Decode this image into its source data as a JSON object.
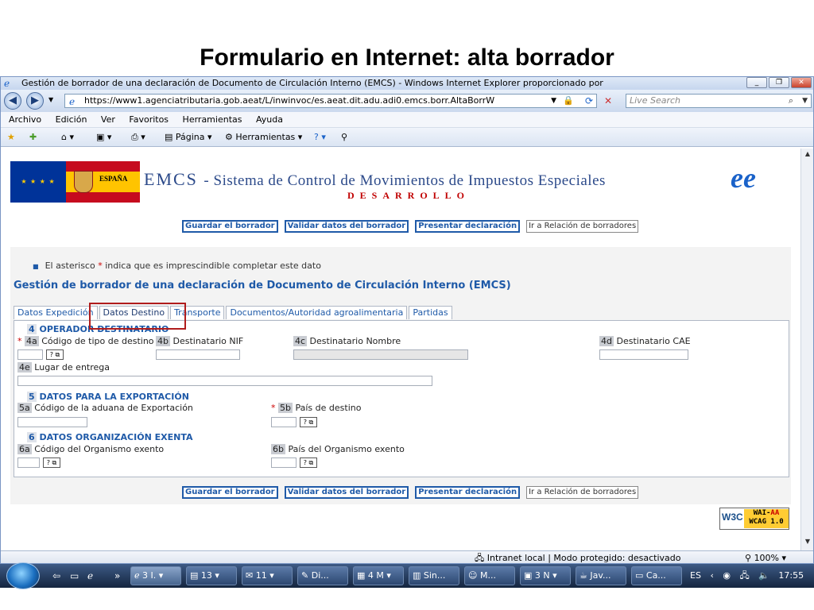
{
  "slide_title": "Formulario en Internet: alta borrador",
  "window": {
    "title": "Gestión de borrador de una declaración de Documento de Circulación Interno (EMCS) - Windows Internet Explorer proporcionado por",
    "url": "https://www1.agenciatributaria.gob.aeat/L/inwinvoc/es.aeat.dit.adu.adi0.emcs.borr.AltaBorrW",
    "search_placeholder": "Live Search",
    "menu": [
      "Archivo",
      "Edición",
      "Ver",
      "Favoritos",
      "Herramientas",
      "Ayuda"
    ],
    "toolbar": {
      "page": "Página",
      "tools": "Herramientas"
    }
  },
  "banner": {
    "emcs": "EMCS",
    "subtitle": "- Sistema de Control de Movimientos de Impuestos Especiales",
    "env": "DESARROLLO",
    "spain_label": "ESPAÑA",
    "logo": "ee"
  },
  "buttons": {
    "save": "Guardar el borrador",
    "validate": "Validar datos del borrador",
    "submit": "Presentar declaración",
    "goto_list": "Ir a Relación de borradores"
  },
  "form": {
    "note_prefix": "El asterisco",
    "note_ast": "*",
    "note_suffix": "indica que es imprescindible completar este dato",
    "title": "Gestión de borrador de una declaración de Documento de Circulación Interno (EMCS)",
    "tabs": [
      "Datos Expedición",
      "Datos Destino",
      "Transporte",
      "Documentos/Autoridad agroalimentaria",
      "Partidas"
    ],
    "active_tab": "Datos Destino",
    "sections": {
      "s4": {
        "num": "4",
        "title": "OPERADOR DESTINATARIO"
      },
      "s5": {
        "num": "5",
        "title": "DATOS PARA LA EXPORTACIÓN"
      },
      "s6": {
        "num": "6",
        "title": "DATOS ORGANIZACIÓN EXENTA"
      }
    },
    "fields": {
      "f4a": {
        "code": "4a",
        "label": "Código de tipo de destino",
        "required": "*"
      },
      "f4b": {
        "code": "4b",
        "label": "Destinatario NIF"
      },
      "f4c": {
        "code": "4c",
        "label": "Destinatario Nombre"
      },
      "f4d": {
        "code": "4d",
        "label": "Destinatario CAE"
      },
      "f4e": {
        "code": "4e",
        "label": "Lugar de entrega"
      },
      "f5a": {
        "code": "5a",
        "label": "Código de la aduana de Exportación"
      },
      "f5b": {
        "code": "5b",
        "label": "País de destino",
        "required": "*"
      },
      "f6a": {
        "code": "6a",
        "label": "Código del Organismo exento"
      },
      "f6b": {
        "code": "6b",
        "label": "País del Organismo exento"
      }
    },
    "help_label": "? ⧉"
  },
  "w3c": {
    "w": "W3C",
    "wai": "WAI-",
    "aa": "AA",
    "wcag": "WCAG 1.0"
  },
  "status": {
    "zone": "Intranet local | Modo protegido: desactivado",
    "zoom": "100%"
  },
  "taskbar": {
    "tasks": [
      "3 I.",
      "13",
      "11",
      "Di...",
      "4 M",
      "Sin...",
      "M...",
      "3 N",
      "Jav...",
      "Ca..."
    ],
    "lang": "ES",
    "clock": "17:55"
  }
}
